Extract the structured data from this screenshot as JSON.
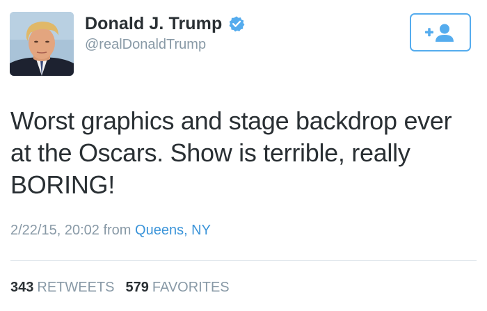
{
  "user": {
    "display_name": "Donald J. Trump",
    "handle": "@realDonaldTrump",
    "verified_icon": "verified-badge-icon"
  },
  "follow_button": {
    "icon": "follow-add-user-icon"
  },
  "tweet": {
    "text": "Worst graphics and stage backdrop ever\nat the Oscars. Show is terrible, really\nBORING!",
    "timestamp": "2/22/15, 20:02",
    "from_label": "from",
    "location": "Queens, NY"
  },
  "stats": {
    "retweets_count": "343",
    "retweets_label": "RETWEETS",
    "favorites_count": "579",
    "favorites_label": "FAVORITES"
  },
  "colors": {
    "accent": "#55acee",
    "link": "#3b94d9",
    "text": "#292f33",
    "muted": "#8899a6",
    "divider": "#e1e8ed"
  }
}
